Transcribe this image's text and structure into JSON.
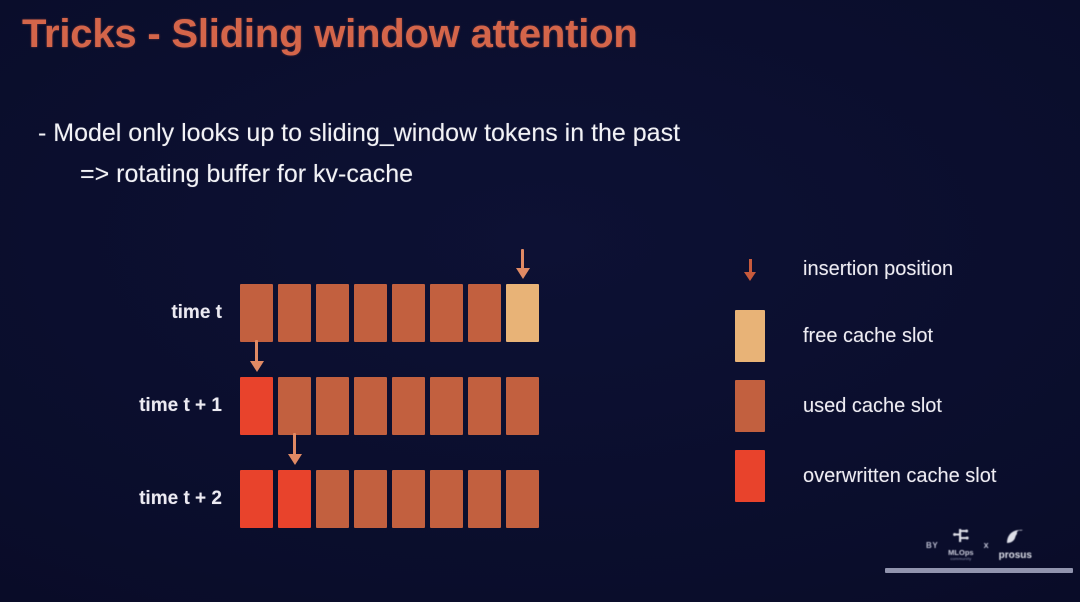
{
  "slide": {
    "title": "Tricks - Sliding window attention",
    "title_color": "#d4654a",
    "background_color": "#0a0d2b",
    "bullets": [
      "-  Model only looks up to sliding_window tokens in the past",
      "=> rotating buffer for kv-cache"
    ]
  },
  "colors": {
    "free": "#e8b377",
    "used": "#c2603f",
    "overwritten": "#e8432c",
    "arrow": "#e08a64",
    "text": "#f2f2f6"
  },
  "diagram": {
    "slot_count": 8,
    "rows": [
      {
        "label": "time t",
        "slots": [
          "used",
          "used",
          "used",
          "used",
          "used",
          "used",
          "used",
          "free"
        ],
        "arrow_index": 7
      },
      {
        "label": "time t + 1",
        "slots": [
          "overwritten",
          "used",
          "used",
          "used",
          "used",
          "used",
          "used",
          "used"
        ],
        "arrow_index": 0
      },
      {
        "label": "time t + 2",
        "slots": [
          "overwritten",
          "overwritten",
          "used",
          "used",
          "used",
          "used",
          "used",
          "used"
        ],
        "arrow_index": 1
      }
    ]
  },
  "legend": {
    "items": [
      {
        "key": "arrow",
        "label": "insertion position"
      },
      {
        "key": "free",
        "label": "free cache slot"
      },
      {
        "key": "used",
        "label": "used cache slot"
      },
      {
        "key": "overwritten",
        "label": "overwritten cache slot"
      }
    ]
  },
  "footer": {
    "by_label": "BY",
    "separator": "x",
    "mlops_name": "MLOps",
    "mlops_sub": "community",
    "prosus_name": "prosus"
  }
}
